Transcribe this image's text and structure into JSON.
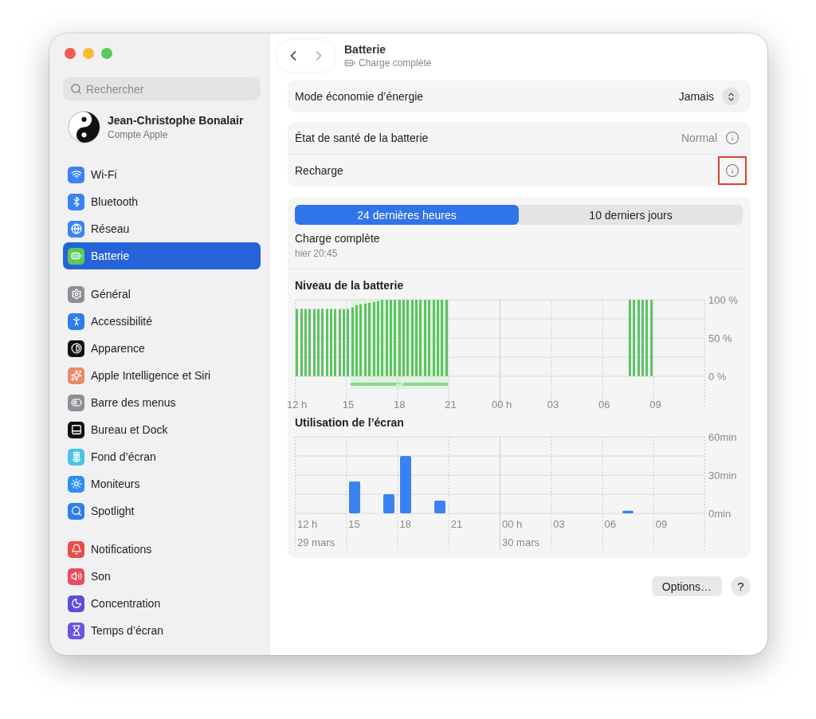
{
  "search": {
    "placeholder": "Rechercher"
  },
  "account": {
    "name": "Jean-Christophe Bonalair",
    "subtitle": "Compte Apple"
  },
  "sidebar": {
    "groups": [
      {
        "items": [
          {
            "label": "Wi-Fi",
            "color": "#3b82f6",
            "selected": false
          },
          {
            "label": "Bluetooth",
            "color": "#3b82f6",
            "selected": false
          },
          {
            "label": "Réseau",
            "color": "#3b82f6",
            "selected": false
          },
          {
            "label": "Batterie",
            "color": "#5cc85c",
            "selected": true
          }
        ]
      },
      {
        "items": [
          {
            "label": "Général",
            "color": "#8e8e93",
            "selected": false
          },
          {
            "label": "Accessibilité",
            "color": "#2f7fe8",
            "selected": false
          },
          {
            "label": "Apparence",
            "color": "#111111",
            "selected": false
          },
          {
            "label": "Apple Intelligence et Siri",
            "color": "#e98a6a",
            "selected": false
          },
          {
            "label": "Barre des menus",
            "color": "#8e8e93",
            "selected": false
          },
          {
            "label": "Bureau et Dock",
            "color": "#111111",
            "selected": false
          },
          {
            "label": "Fond d’écran",
            "color": "#4cc3e6",
            "selected": false
          },
          {
            "label": "Moniteurs",
            "color": "#2f8ef0",
            "selected": false
          },
          {
            "label": "Spotlight",
            "color": "#2f7fe8",
            "selected": false
          }
        ]
      },
      {
        "items": [
          {
            "label": "Notifications",
            "color": "#ec4b4b",
            "selected": false
          },
          {
            "label": "Son",
            "color": "#ec4b5e",
            "selected": false
          },
          {
            "label": "Concentration",
            "color": "#5b4fd8",
            "selected": false
          },
          {
            "label": "Temps d’écran",
            "color": "#6b55e0",
            "selected": false
          }
        ]
      }
    ]
  },
  "header": {
    "title": "Batterie",
    "subtitle": "Charge complète"
  },
  "energy_mode": {
    "label": "Mode économie d’énergie",
    "value": "Jamais"
  },
  "health_rows": [
    {
      "label": "État de santé de la batterie",
      "value": "Normal",
      "highlighted": false
    },
    {
      "label": "Recharge",
      "highlighted": true
    }
  ],
  "tabs": [
    {
      "label": "24 dernières heures",
      "selected": true
    },
    {
      "label": "10 derniers jours",
      "selected": false
    }
  ],
  "last_charge": {
    "title": "Charge complète",
    "time": "hier 20:45"
  },
  "battery_chart": {
    "chart_data": {
      "type": "bar",
      "title": "Niveau de la batterie",
      "ylim": [
        0,
        100
      ],
      "yticks": [
        {
          "value": 0,
          "label": "0 %"
        },
        {
          "value": 50,
          "label": "50 %"
        },
        {
          "value": 100,
          "label": "100 %"
        }
      ],
      "categories": [
        "12 h",
        null,
        null,
        null,
        null,
        null,
        null,
        null,
        null,
        null,
        null,
        null,
        "15",
        null,
        null,
        null,
        null,
        null,
        null,
        null,
        null,
        null,
        null,
        null,
        "18",
        null,
        null,
        null,
        null,
        null,
        null,
        null,
        null,
        null,
        null,
        null,
        "21",
        null,
        null,
        null,
        null,
        null,
        null,
        null,
        null,
        null,
        null,
        null,
        "00 h",
        null,
        null,
        null,
        null,
        null,
        null,
        null,
        null,
        null,
        null,
        null,
        "03",
        null,
        null,
        null,
        null,
        null,
        null,
        null,
        null,
        null,
        null,
        null,
        "06",
        null,
        null,
        null,
        null,
        null,
        null,
        null,
        null,
        null,
        null,
        null,
        "09",
        null,
        null,
        null,
        null,
        null,
        null,
        null,
        null,
        null,
        null,
        null
      ],
      "series": [
        {
          "color": "#5cc461",
          "values": [
            88,
            88,
            88,
            88,
            88,
            88,
            88,
            88,
            88,
            88,
            88,
            88,
            88,
            90,
            93,
            94,
            95,
            96,
            97,
            98,
            100,
            100,
            100,
            100,
            100,
            100,
            100,
            100,
            100,
            100,
            100,
            100,
            100,
            100,
            100,
            100,
            null,
            null,
            null,
            null,
            null,
            null,
            null,
            null,
            null,
            null,
            null,
            null,
            null,
            null,
            null,
            null,
            null,
            null,
            null,
            null,
            null,
            null,
            null,
            null,
            null,
            null,
            null,
            null,
            null,
            null,
            null,
            null,
            null,
            null,
            null,
            null,
            null,
            null,
            null,
            null,
            null,
            null,
            100,
            100,
            100,
            100,
            100,
            100,
            null,
            null,
            null,
            null,
            null,
            null,
            null,
            null,
            null,
            null,
            null,
            null
          ]
        }
      ]
    },
    "charging": true
  },
  "usage_chart": {
    "chart_data": {
      "type": "bar",
      "title": "Utilisation de l’écran",
      "ylim": [
        0,
        60
      ],
      "yticks": [
        {
          "value": 0,
          "label": "0min"
        },
        {
          "value": 30,
          "label": "30min"
        },
        {
          "value": 60,
          "label": "60min"
        }
      ],
      "categories": [
        "12 h",
        null,
        null,
        "15",
        null,
        null,
        "18",
        null,
        null,
        "21",
        null,
        null,
        "00 h",
        null,
        null,
        "03",
        null,
        null,
        "06",
        null,
        null,
        "09",
        null,
        null
      ],
      "series": [
        {
          "color": "#3a82f0",
          "values": [
            0,
            0,
            0,
            25,
            0,
            15,
            45,
            0,
            10,
            0,
            0,
            0,
            0,
            0,
            0,
            0,
            0,
            0,
            0,
            2,
            0,
            0,
            0,
            0
          ]
        }
      ]
    },
    "dates": [
      "29 mars",
      "30 mars"
    ]
  },
  "footer": {
    "options": "Options…",
    "help": "?"
  }
}
